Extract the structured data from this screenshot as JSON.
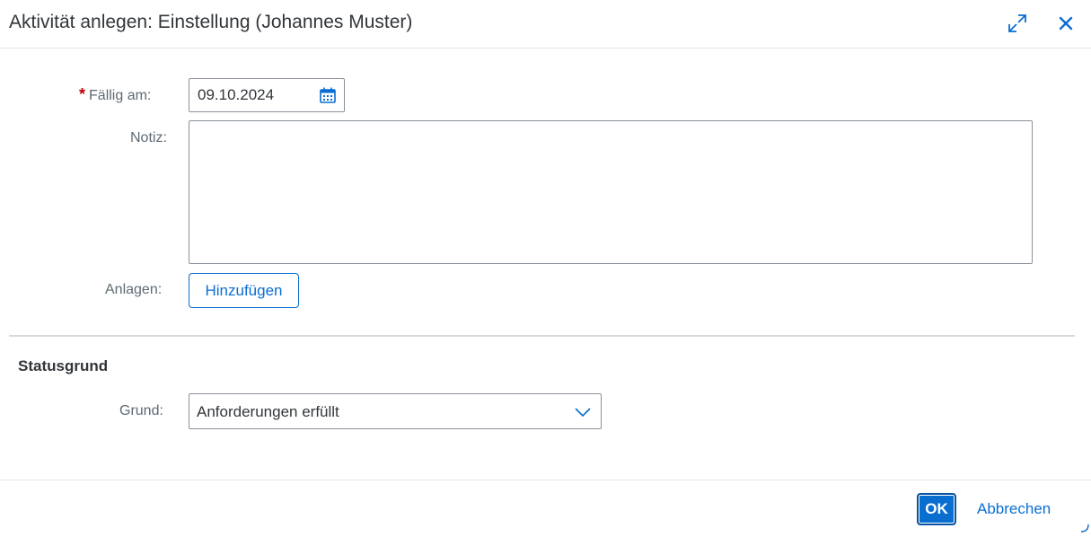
{
  "dialog": {
    "title": "Aktivität anlegen: Einstellung (Johannes Muster)",
    "icons": {
      "expand": "expand-icon",
      "close": "close-icon"
    }
  },
  "form": {
    "due_date": {
      "required_marker": "*",
      "label": "Fällig am:",
      "value": "09.10.2024",
      "icon": "calendar-icon"
    },
    "note": {
      "label": "Notiz:",
      "value": ""
    },
    "attachments": {
      "label": "Anlagen:",
      "button_label": "Hinzufügen"
    }
  },
  "status_section": {
    "title": "Statusgrund",
    "reason": {
      "label": "Grund:",
      "selected": "Anforderungen erfüllt",
      "icon": "chevron-down-icon"
    }
  },
  "footer": {
    "ok_label": "OK",
    "cancel_label": "Abbrechen"
  },
  "colors": {
    "accent": "#0a6ed1",
    "required": "#bb0000",
    "label": "#5f6b74",
    "text": "#32363a",
    "border": "#89919a"
  }
}
